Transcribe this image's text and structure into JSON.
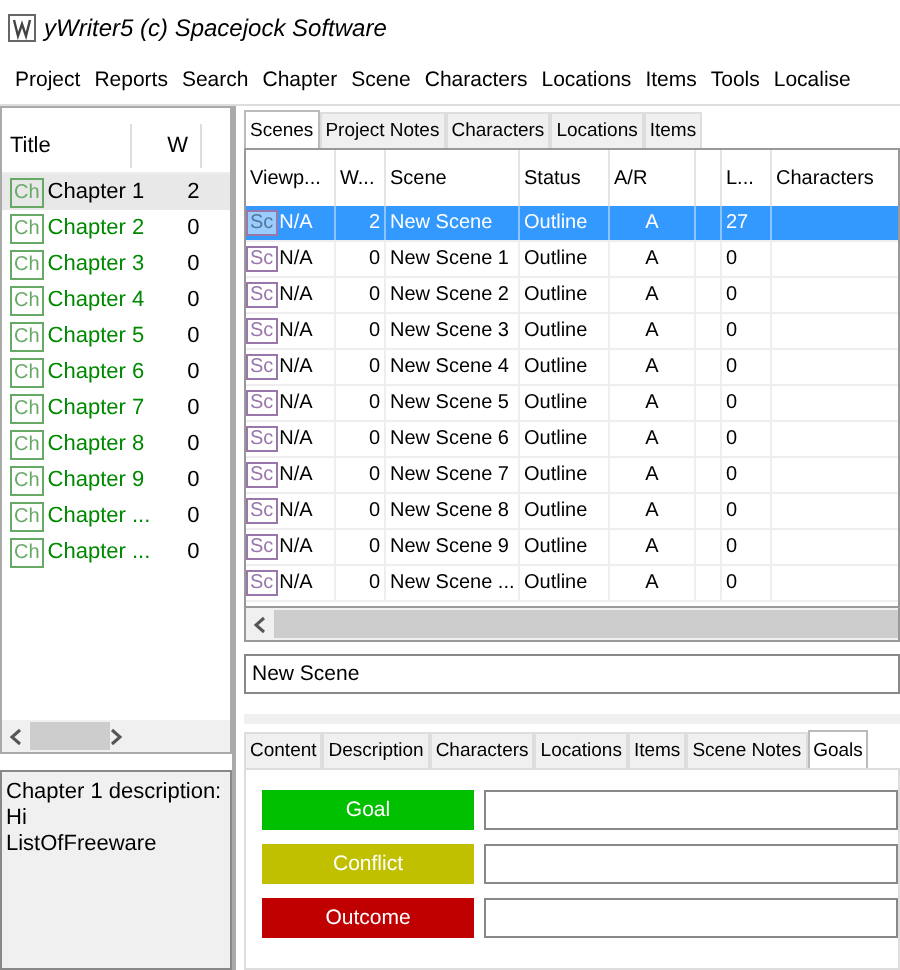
{
  "window": {
    "title": "yWriter5 (c) Spacejock Software"
  },
  "menu": [
    "Project",
    "Reports",
    "Search",
    "Chapter",
    "Scene",
    "Characters",
    "Locations",
    "Items",
    "Tools",
    "Localise"
  ],
  "chapters": {
    "columns": [
      "Title",
      "W"
    ],
    "rows": [
      {
        "icon": "Ch",
        "title": "Chapter 1",
        "words": "2",
        "selected": true
      },
      {
        "icon": "Ch",
        "title": "Chapter 2",
        "words": "0",
        "selected": false
      },
      {
        "icon": "Ch",
        "title": "Chapter 3",
        "words": "0",
        "selected": false
      },
      {
        "icon": "Ch",
        "title": "Chapter 4",
        "words": "0",
        "selected": false
      },
      {
        "icon": "Ch",
        "title": "Chapter 5",
        "words": "0",
        "selected": false
      },
      {
        "icon": "Ch",
        "title": "Chapter 6",
        "words": "0",
        "selected": false
      },
      {
        "icon": "Ch",
        "title": "Chapter 7",
        "words": "0",
        "selected": false
      },
      {
        "icon": "Ch",
        "title": "Chapter 8",
        "words": "0",
        "selected": false
      },
      {
        "icon": "Ch",
        "title": "Chapter 9",
        "words": "0",
        "selected": false
      },
      {
        "icon": "Ch",
        "title": "Chapter ...",
        "words": "0",
        "selected": false
      },
      {
        "icon": "Ch",
        "title": "Chapter ...",
        "words": "0",
        "selected": false
      }
    ]
  },
  "description": [
    "Chapter 1 description:",
    "Hi",
    "ListOfFreeware"
  ],
  "tabs": [
    {
      "label": "Scenes",
      "selected": true
    },
    {
      "label": "Project Notes",
      "selected": false
    },
    {
      "label": "Characters",
      "selected": false
    },
    {
      "label": "Locations",
      "selected": false
    },
    {
      "label": "Items",
      "selected": false
    }
  ],
  "scenes": {
    "columns": [
      "Viewp...",
      "W...",
      "Scene",
      "Status",
      "A/R",
      "",
      "L...",
      "Characters"
    ],
    "rows": [
      {
        "icon": "Sc",
        "cells": [
          "N/A",
          "2",
          "New Scene",
          "Outline",
          "A",
          "",
          "27",
          ""
        ],
        "selected": true
      },
      {
        "icon": "Sc",
        "cells": [
          "N/A",
          "0",
          "New Scene 1",
          "Outline",
          "A",
          "",
          "0",
          ""
        ],
        "selected": false
      },
      {
        "icon": "Sc",
        "cells": [
          "N/A",
          "0",
          "New Scene 2",
          "Outline",
          "A",
          "",
          "0",
          ""
        ],
        "selected": false
      },
      {
        "icon": "Sc",
        "cells": [
          "N/A",
          "0",
          "New Scene 3",
          "Outline",
          "A",
          "",
          "0",
          ""
        ],
        "selected": false
      },
      {
        "icon": "Sc",
        "cells": [
          "N/A",
          "0",
          "New Scene 4",
          "Outline",
          "A",
          "",
          "0",
          ""
        ],
        "selected": false
      },
      {
        "icon": "Sc",
        "cells": [
          "N/A",
          "0",
          "New Scene 5",
          "Outline",
          "A",
          "",
          "0",
          ""
        ],
        "selected": false
      },
      {
        "icon": "Sc",
        "cells": [
          "N/A",
          "0",
          "New Scene 6",
          "Outline",
          "A",
          "",
          "0",
          ""
        ],
        "selected": false
      },
      {
        "icon": "Sc",
        "cells": [
          "N/A",
          "0",
          "New Scene 7",
          "Outline",
          "A",
          "",
          "0",
          ""
        ],
        "selected": false
      },
      {
        "icon": "Sc",
        "cells": [
          "N/A",
          "0",
          "New Scene 8",
          "Outline",
          "A",
          "",
          "0",
          ""
        ],
        "selected": false
      },
      {
        "icon": "Sc",
        "cells": [
          "N/A",
          "0",
          "New Scene 9",
          "Outline",
          "A",
          "",
          "0",
          ""
        ],
        "selected": false
      },
      {
        "icon": "Sc",
        "cells": [
          "N/A",
          "0",
          "New Scene ...",
          "Outline",
          "A",
          "",
          "0",
          ""
        ],
        "selected": false
      }
    ]
  },
  "scene_name": {
    "value": "New Scene"
  },
  "scene_tabs": [
    {
      "label": "Content",
      "selected": false
    },
    {
      "label": "Description",
      "selected": false
    },
    {
      "label": "Characters",
      "selected": false
    },
    {
      "label": "Locations",
      "selected": false
    },
    {
      "label": "Items",
      "selected": false
    },
    {
      "label": "Scene Notes",
      "selected": false
    },
    {
      "label": "Goals",
      "selected": true
    }
  ],
  "goals": [
    {
      "label": "Goal",
      "color": "#00c000"
    },
    {
      "label": "Conflict",
      "color": "#c0c000"
    },
    {
      "label": "Outcome",
      "color": "#c00000"
    }
  ]
}
